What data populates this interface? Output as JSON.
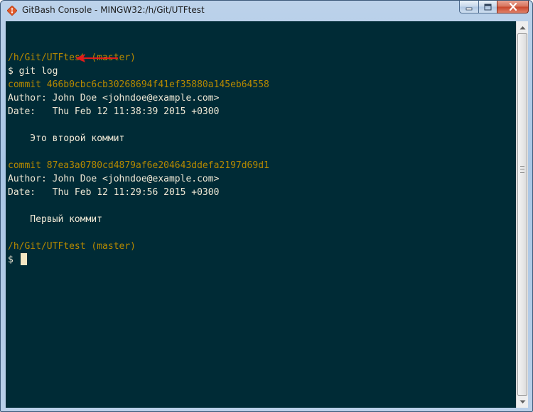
{
  "window": {
    "title": "GitBash Console - MINGW32:/h/Git/UTFtest",
    "icon": "git-diamond-icon"
  },
  "controls": {
    "minimize_icon": "minimize-icon",
    "maximize_icon": "maximize-icon",
    "close_icon": "close-icon"
  },
  "terminal": {
    "lines": [
      {
        "kind": "blank",
        "text": ""
      },
      {
        "kind": "path",
        "text": "/h/Git/UTFtest (master)"
      },
      {
        "kind": "prompt",
        "text": "$ git log"
      },
      {
        "kind": "commit",
        "text": "commit 466b0cbc6cb30268694f41ef35880a145eb64558"
      },
      {
        "kind": "text",
        "text": "Author: John Doe <johndoe@example.com>"
      },
      {
        "kind": "text",
        "text": "Date:   Thu Feb 12 11:38:39 2015 +0300"
      },
      {
        "kind": "blank",
        "text": ""
      },
      {
        "kind": "text",
        "text": "    Это второй коммит"
      },
      {
        "kind": "blank",
        "text": ""
      },
      {
        "kind": "commit",
        "text": "commit 87ea3a0780cd4879af6e204643ddefa2197d69d1"
      },
      {
        "kind": "text",
        "text": "Author: John Doe <johndoe@example.com>"
      },
      {
        "kind": "text",
        "text": "Date:   Thu Feb 12 11:29:56 2015 +0300"
      },
      {
        "kind": "blank",
        "text": ""
      },
      {
        "kind": "text",
        "text": "    Первый коммит"
      },
      {
        "kind": "blank",
        "text": ""
      },
      {
        "kind": "path",
        "text": "/h/Git/UTFtest (master)"
      },
      {
        "kind": "prompt-cursor",
        "text": "$"
      }
    ]
  },
  "colors": {
    "background": "#002b36",
    "path_text": "#b58900",
    "commit_hash": "#b58900",
    "normal_text": "#eee8d5",
    "cursor": "#f3e6c2",
    "annotation_arrow": "#e01b1b"
  },
  "annotation": {
    "icon": "red-arrow-icon"
  },
  "scrollbar": {
    "up_icon": "scroll-up-arrow-icon",
    "down_icon": "scroll-down-arrow-icon"
  }
}
